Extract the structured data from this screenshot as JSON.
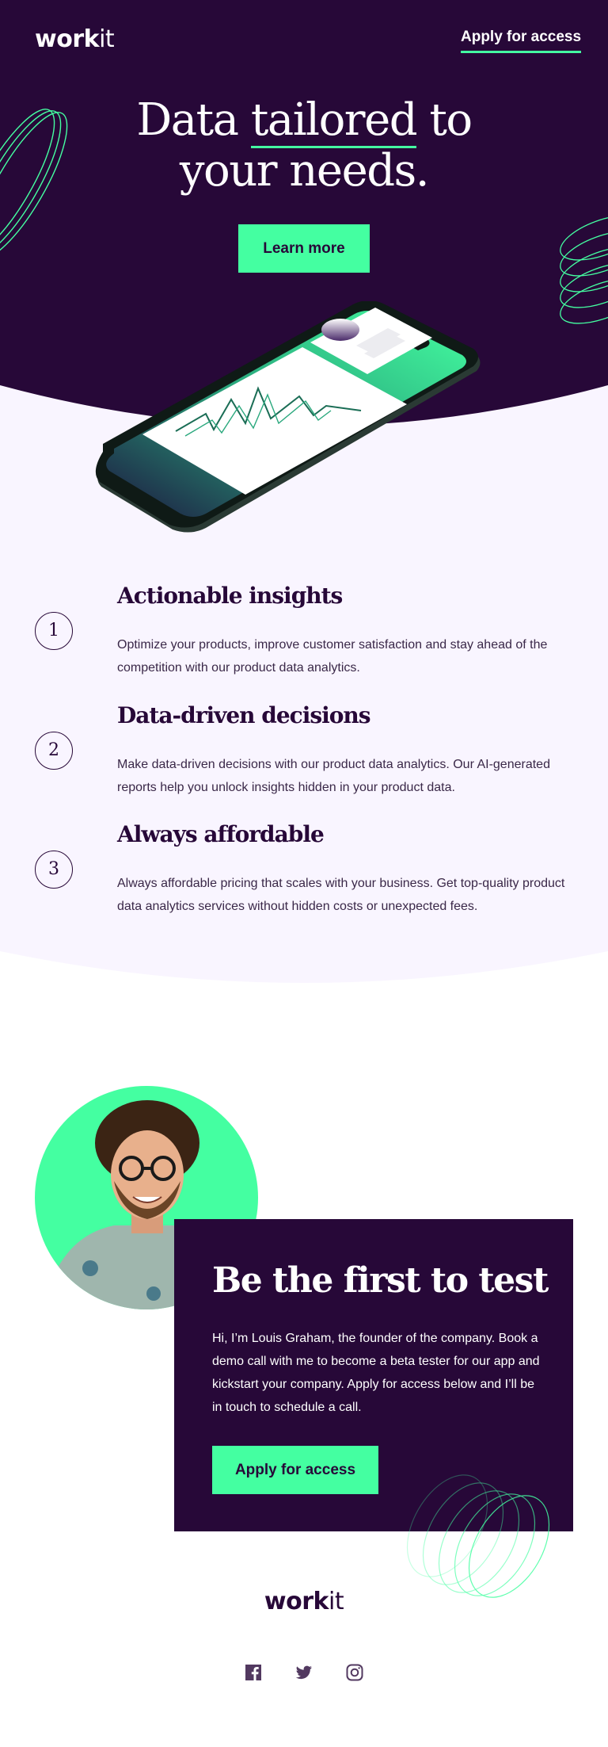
{
  "header": {
    "logo_bold": "work",
    "logo_light": "it",
    "nav_link": "Apply for access"
  },
  "hero": {
    "title_part1": "Data ",
    "title_underlined": "tailored",
    "title_part2": " to",
    "title_line2": "your needs.",
    "cta": "Learn more"
  },
  "features": [
    {
      "number": "1",
      "title": "Actionable insights",
      "body": "Optimize your products, improve customer satisfaction and stay ahead of the competition with our product data analytics."
    },
    {
      "number": "2",
      "title": "Data-driven decisions",
      "body": "Make data-driven decisions with our product data analytics. Our AI-generated reports help you unlock insights hidden in your product data."
    },
    {
      "number": "3",
      "title": "Always affordable",
      "body": "Always affordable pricing that scales with your business. Get top-quality product data analytics services without hidden costs or unexpected fees."
    }
  ],
  "about": {
    "title": "Be the first to test",
    "body": "Hi, I’m Louis Graham, the founder of the company. Book a demo call with me to become a beta tester for our app and kickstart your company. Apply for access below and I’ll be in touch to schedule a call.",
    "cta": "Apply for access"
  },
  "footer": {
    "logo_bold": "work",
    "logo_light": "it",
    "socials": [
      "facebook-icon",
      "twitter-icon",
      "instagram-icon"
    ]
  },
  "colors": {
    "primary": "#270838",
    "accent": "#44ffa1",
    "light_bg": "#f9f5ff"
  }
}
